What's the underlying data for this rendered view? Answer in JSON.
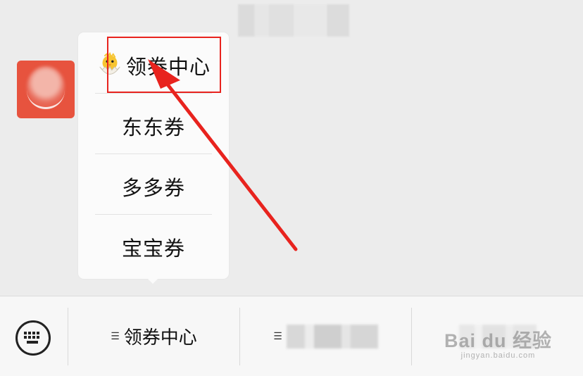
{
  "popup_menu": {
    "items": [
      {
        "label": "领券中心",
        "icon": "chick-icon"
      },
      {
        "label": "东东券"
      },
      {
        "label": "多多券"
      },
      {
        "label": "宝宝券"
      }
    ]
  },
  "bottom_bar": {
    "tabs": [
      {
        "label": "领券中心",
        "icon": "menu-list-icon"
      },
      {
        "label": "",
        "icon": "menu-list-icon"
      },
      {
        "label": ""
      }
    ]
  },
  "annotation": {
    "highlight_color": "#e8231e"
  },
  "watermark": {
    "main": "Bai du 经验",
    "sub": "jingyan.baidu.com"
  }
}
